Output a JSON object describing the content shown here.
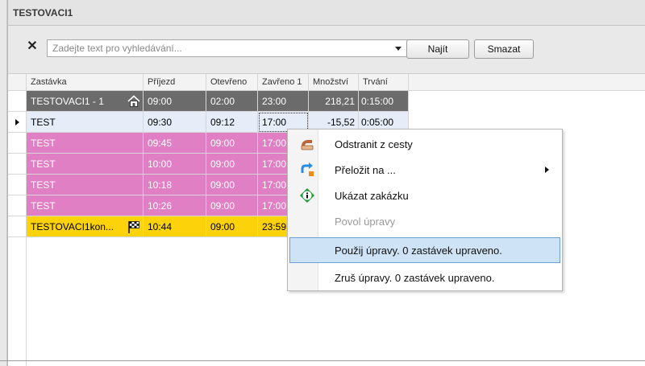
{
  "panel": {
    "title": "TESTOVACI1"
  },
  "search": {
    "placeholder": "Zadejte text pro vyhledávání...",
    "value": "",
    "find_label": "Najít",
    "clear_label": "Smazat"
  },
  "grid": {
    "columns": [
      "Zastávka",
      "Příjezd",
      "Otevřeno",
      "Zavřeno 1",
      "Množství",
      "Trvání"
    ],
    "rows": [
      {
        "stop": "TESTOVACI1 - 1",
        "arrival": "09:00",
        "open": "02:00",
        "close": "23:00",
        "qty": "218,21",
        "duration": "0:15:00",
        "icon": "home-icon"
      },
      {
        "stop": "TEST",
        "arrival": "09:30",
        "open": "09:12",
        "close": "17:00",
        "qty": "-15,52",
        "duration": "0:05:00",
        "icon": ""
      },
      {
        "stop": "TEST",
        "arrival": "09:45",
        "open": "09:00",
        "close": "17:00",
        "qty": "",
        "duration": "",
        "icon": ""
      },
      {
        "stop": "TEST",
        "arrival": "10:00",
        "open": "09:00",
        "close": "17:00",
        "qty": "",
        "duration": "",
        "icon": ""
      },
      {
        "stop": "TEST",
        "arrival": "10:18",
        "open": "09:00",
        "close": "17:00",
        "qty": "",
        "duration": "",
        "icon": ""
      },
      {
        "stop": "TEST",
        "arrival": "10:26",
        "open": "09:00",
        "close": "17:00",
        "qty": "",
        "duration": "",
        "icon": ""
      },
      {
        "stop": "TESTOVACI1kon...",
        "arrival": "10:44",
        "open": "09:00",
        "close": "23:59",
        "qty": "",
        "duration": "",
        "icon": "finish-flag-icon"
      }
    ]
  },
  "context_menu": {
    "items": [
      {
        "label": "Odstranit z cesty",
        "icon": "remove-from-route-icon",
        "enabled": true
      },
      {
        "label": "Přeložit na ...",
        "icon": "move-to-icon",
        "enabled": true,
        "submenu": true
      },
      {
        "label": "Ukázat zakázku",
        "icon": "info-icon",
        "enabled": true
      },
      {
        "label": "Povol úpravy",
        "icon": "",
        "enabled": false
      },
      {
        "label": "Použij úpravy. 0 zastávek upraveno.",
        "icon": "",
        "enabled": true,
        "highlighted": true
      },
      {
        "label": "Zruš úpravy. 0 zastávek upraveno.",
        "icon": "",
        "enabled": true
      }
    ]
  },
  "colors": {
    "row_start": "#6b6b6b",
    "row_selected": "#e6edf8",
    "row_pink": "#e07fc3",
    "row_end": "#fcd20a",
    "menu_highlight": "#cfe3f6"
  }
}
